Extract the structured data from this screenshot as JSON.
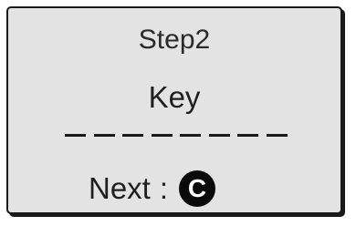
{
  "screen": {
    "step_title": "Step2",
    "prompt_label": "Key",
    "key_slots": [
      "",
      "",
      "",
      "",
      "",
      "",
      "",
      ""
    ],
    "next": {
      "label": "Next",
      "separator": ":",
      "key_symbol": "C",
      "key_icon": "c-button-icon"
    },
    "colors": {
      "panel_background": "#e3e3e3",
      "border": "#1a1a1a",
      "key_button": "#0a0a0a"
    }
  }
}
